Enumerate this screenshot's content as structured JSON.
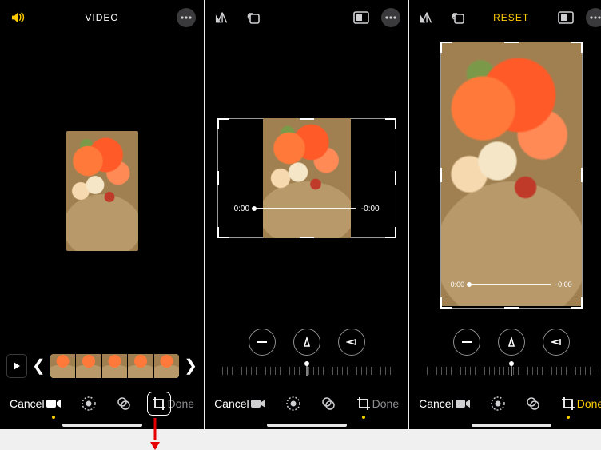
{
  "panel1": {
    "title": "VIDEO",
    "cancel": "Cancel",
    "done": "Done"
  },
  "panel2": {
    "time_start": "0:00",
    "time_end": "-0:00",
    "cancel": "Cancel",
    "done": "Done"
  },
  "panel3": {
    "reset": "RESET",
    "time_start": "0:00",
    "time_end": "-0:00",
    "cancel": "Cancel",
    "done": "Done"
  }
}
